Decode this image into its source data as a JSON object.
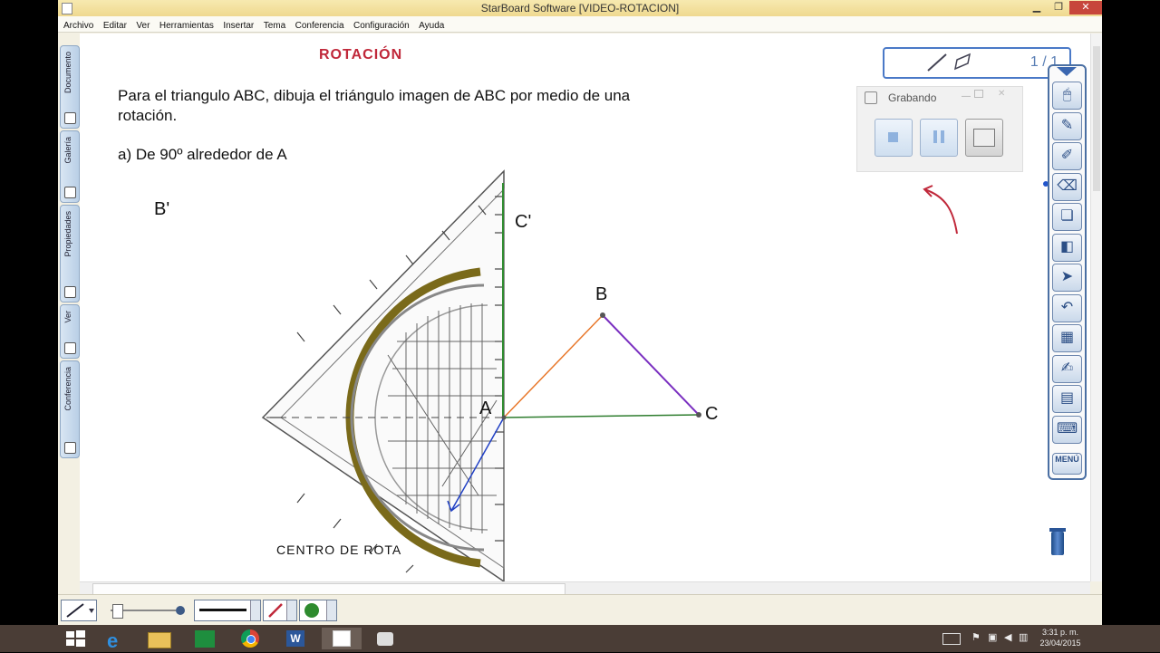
{
  "window": {
    "title": "StarBoard Software [VIDEO-ROTACION]",
    "minimize": "▁",
    "restore": "❐",
    "close": "✕"
  },
  "menu": [
    "Archivo",
    "Editar",
    "Ver",
    "Herramientas",
    "Insertar",
    "Tema",
    "Conferencia",
    "Configuración",
    "Ayuda"
  ],
  "side_tabs": [
    {
      "label": "Documento",
      "icon": "document-icon"
    },
    {
      "label": "Galería",
      "icon": "gallery-icon"
    },
    {
      "label": "Propiedades",
      "icon": "properties-icon"
    },
    {
      "label": "Ver",
      "icon": "view-icon"
    },
    {
      "label": "Conferencia",
      "icon": "conference-icon"
    }
  ],
  "page": {
    "heading": "ROTACIÓN",
    "instruction_line1": "Para el triangulo ABC, dibuja el triángulo imagen de ABC por medio de una",
    "instruction_line2": "rotación.",
    "item_a": "a) De 90º alrededor de A",
    "label_b_prime": "B'",
    "label_c_prime": "C'",
    "label_a": "A",
    "label_b": "B",
    "label_c": "C",
    "center_label": "CENTRO DE ROTA",
    "heading_color": "#c0283a"
  },
  "page_nav": {
    "counter": "1 / 1"
  },
  "recorder": {
    "title": "Grabando",
    "buttons": [
      "stop",
      "pause",
      "screen"
    ]
  },
  "toolbar_icons": [
    "mouse-icon",
    "pen-icon",
    "highlighter-icon",
    "eraser-icon",
    "layers-icon",
    "shapes-icon",
    "pointer-icon",
    "undo-icon",
    "page-sorter-icon",
    "brush-icon",
    "whiteboard-icon",
    "keyboard-icon"
  ],
  "toolbar_menu": "MENÚ",
  "taskbar": {
    "time": "3:31 p. m.",
    "date": "23/04/2015"
  }
}
